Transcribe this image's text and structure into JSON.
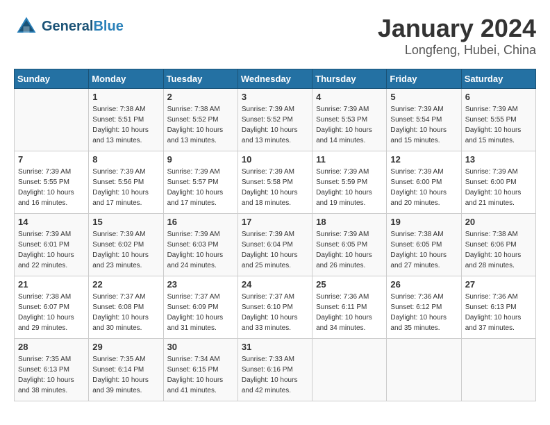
{
  "header": {
    "logo_line1": "General",
    "logo_line2": "Blue",
    "month": "January 2024",
    "location": "Longfeng, Hubei, China"
  },
  "days_of_week": [
    "Sunday",
    "Monday",
    "Tuesday",
    "Wednesday",
    "Thursday",
    "Friday",
    "Saturday"
  ],
  "weeks": [
    [
      {
        "num": "",
        "info": ""
      },
      {
        "num": "1",
        "info": "Sunrise: 7:38 AM\nSunset: 5:51 PM\nDaylight: 10 hours\nand 13 minutes."
      },
      {
        "num": "2",
        "info": "Sunrise: 7:38 AM\nSunset: 5:52 PM\nDaylight: 10 hours\nand 13 minutes."
      },
      {
        "num": "3",
        "info": "Sunrise: 7:39 AM\nSunset: 5:52 PM\nDaylight: 10 hours\nand 13 minutes."
      },
      {
        "num": "4",
        "info": "Sunrise: 7:39 AM\nSunset: 5:53 PM\nDaylight: 10 hours\nand 14 minutes."
      },
      {
        "num": "5",
        "info": "Sunrise: 7:39 AM\nSunset: 5:54 PM\nDaylight: 10 hours\nand 15 minutes."
      },
      {
        "num": "6",
        "info": "Sunrise: 7:39 AM\nSunset: 5:55 PM\nDaylight: 10 hours\nand 15 minutes."
      }
    ],
    [
      {
        "num": "7",
        "info": "Sunrise: 7:39 AM\nSunset: 5:55 PM\nDaylight: 10 hours\nand 16 minutes."
      },
      {
        "num": "8",
        "info": "Sunrise: 7:39 AM\nSunset: 5:56 PM\nDaylight: 10 hours\nand 17 minutes."
      },
      {
        "num": "9",
        "info": "Sunrise: 7:39 AM\nSunset: 5:57 PM\nDaylight: 10 hours\nand 17 minutes."
      },
      {
        "num": "10",
        "info": "Sunrise: 7:39 AM\nSunset: 5:58 PM\nDaylight: 10 hours\nand 18 minutes."
      },
      {
        "num": "11",
        "info": "Sunrise: 7:39 AM\nSunset: 5:59 PM\nDaylight: 10 hours\nand 19 minutes."
      },
      {
        "num": "12",
        "info": "Sunrise: 7:39 AM\nSunset: 6:00 PM\nDaylight: 10 hours\nand 20 minutes."
      },
      {
        "num": "13",
        "info": "Sunrise: 7:39 AM\nSunset: 6:00 PM\nDaylight: 10 hours\nand 21 minutes."
      }
    ],
    [
      {
        "num": "14",
        "info": "Sunrise: 7:39 AM\nSunset: 6:01 PM\nDaylight: 10 hours\nand 22 minutes."
      },
      {
        "num": "15",
        "info": "Sunrise: 7:39 AM\nSunset: 6:02 PM\nDaylight: 10 hours\nand 23 minutes."
      },
      {
        "num": "16",
        "info": "Sunrise: 7:39 AM\nSunset: 6:03 PM\nDaylight: 10 hours\nand 24 minutes."
      },
      {
        "num": "17",
        "info": "Sunrise: 7:39 AM\nSunset: 6:04 PM\nDaylight: 10 hours\nand 25 minutes."
      },
      {
        "num": "18",
        "info": "Sunrise: 7:39 AM\nSunset: 6:05 PM\nDaylight: 10 hours\nand 26 minutes."
      },
      {
        "num": "19",
        "info": "Sunrise: 7:38 AM\nSunset: 6:05 PM\nDaylight: 10 hours\nand 27 minutes."
      },
      {
        "num": "20",
        "info": "Sunrise: 7:38 AM\nSunset: 6:06 PM\nDaylight: 10 hours\nand 28 minutes."
      }
    ],
    [
      {
        "num": "21",
        "info": "Sunrise: 7:38 AM\nSunset: 6:07 PM\nDaylight: 10 hours\nand 29 minutes."
      },
      {
        "num": "22",
        "info": "Sunrise: 7:37 AM\nSunset: 6:08 PM\nDaylight: 10 hours\nand 30 minutes."
      },
      {
        "num": "23",
        "info": "Sunrise: 7:37 AM\nSunset: 6:09 PM\nDaylight: 10 hours\nand 31 minutes."
      },
      {
        "num": "24",
        "info": "Sunrise: 7:37 AM\nSunset: 6:10 PM\nDaylight: 10 hours\nand 33 minutes."
      },
      {
        "num": "25",
        "info": "Sunrise: 7:36 AM\nSunset: 6:11 PM\nDaylight: 10 hours\nand 34 minutes."
      },
      {
        "num": "26",
        "info": "Sunrise: 7:36 AM\nSunset: 6:12 PM\nDaylight: 10 hours\nand 35 minutes."
      },
      {
        "num": "27",
        "info": "Sunrise: 7:36 AM\nSunset: 6:13 PM\nDaylight: 10 hours\nand 37 minutes."
      }
    ],
    [
      {
        "num": "28",
        "info": "Sunrise: 7:35 AM\nSunset: 6:13 PM\nDaylight: 10 hours\nand 38 minutes."
      },
      {
        "num": "29",
        "info": "Sunrise: 7:35 AM\nSunset: 6:14 PM\nDaylight: 10 hours\nand 39 minutes."
      },
      {
        "num": "30",
        "info": "Sunrise: 7:34 AM\nSunset: 6:15 PM\nDaylight: 10 hours\nand 41 minutes."
      },
      {
        "num": "31",
        "info": "Sunrise: 7:33 AM\nSunset: 6:16 PM\nDaylight: 10 hours\nand 42 minutes."
      },
      {
        "num": "",
        "info": ""
      },
      {
        "num": "",
        "info": ""
      },
      {
        "num": "",
        "info": ""
      }
    ]
  ]
}
